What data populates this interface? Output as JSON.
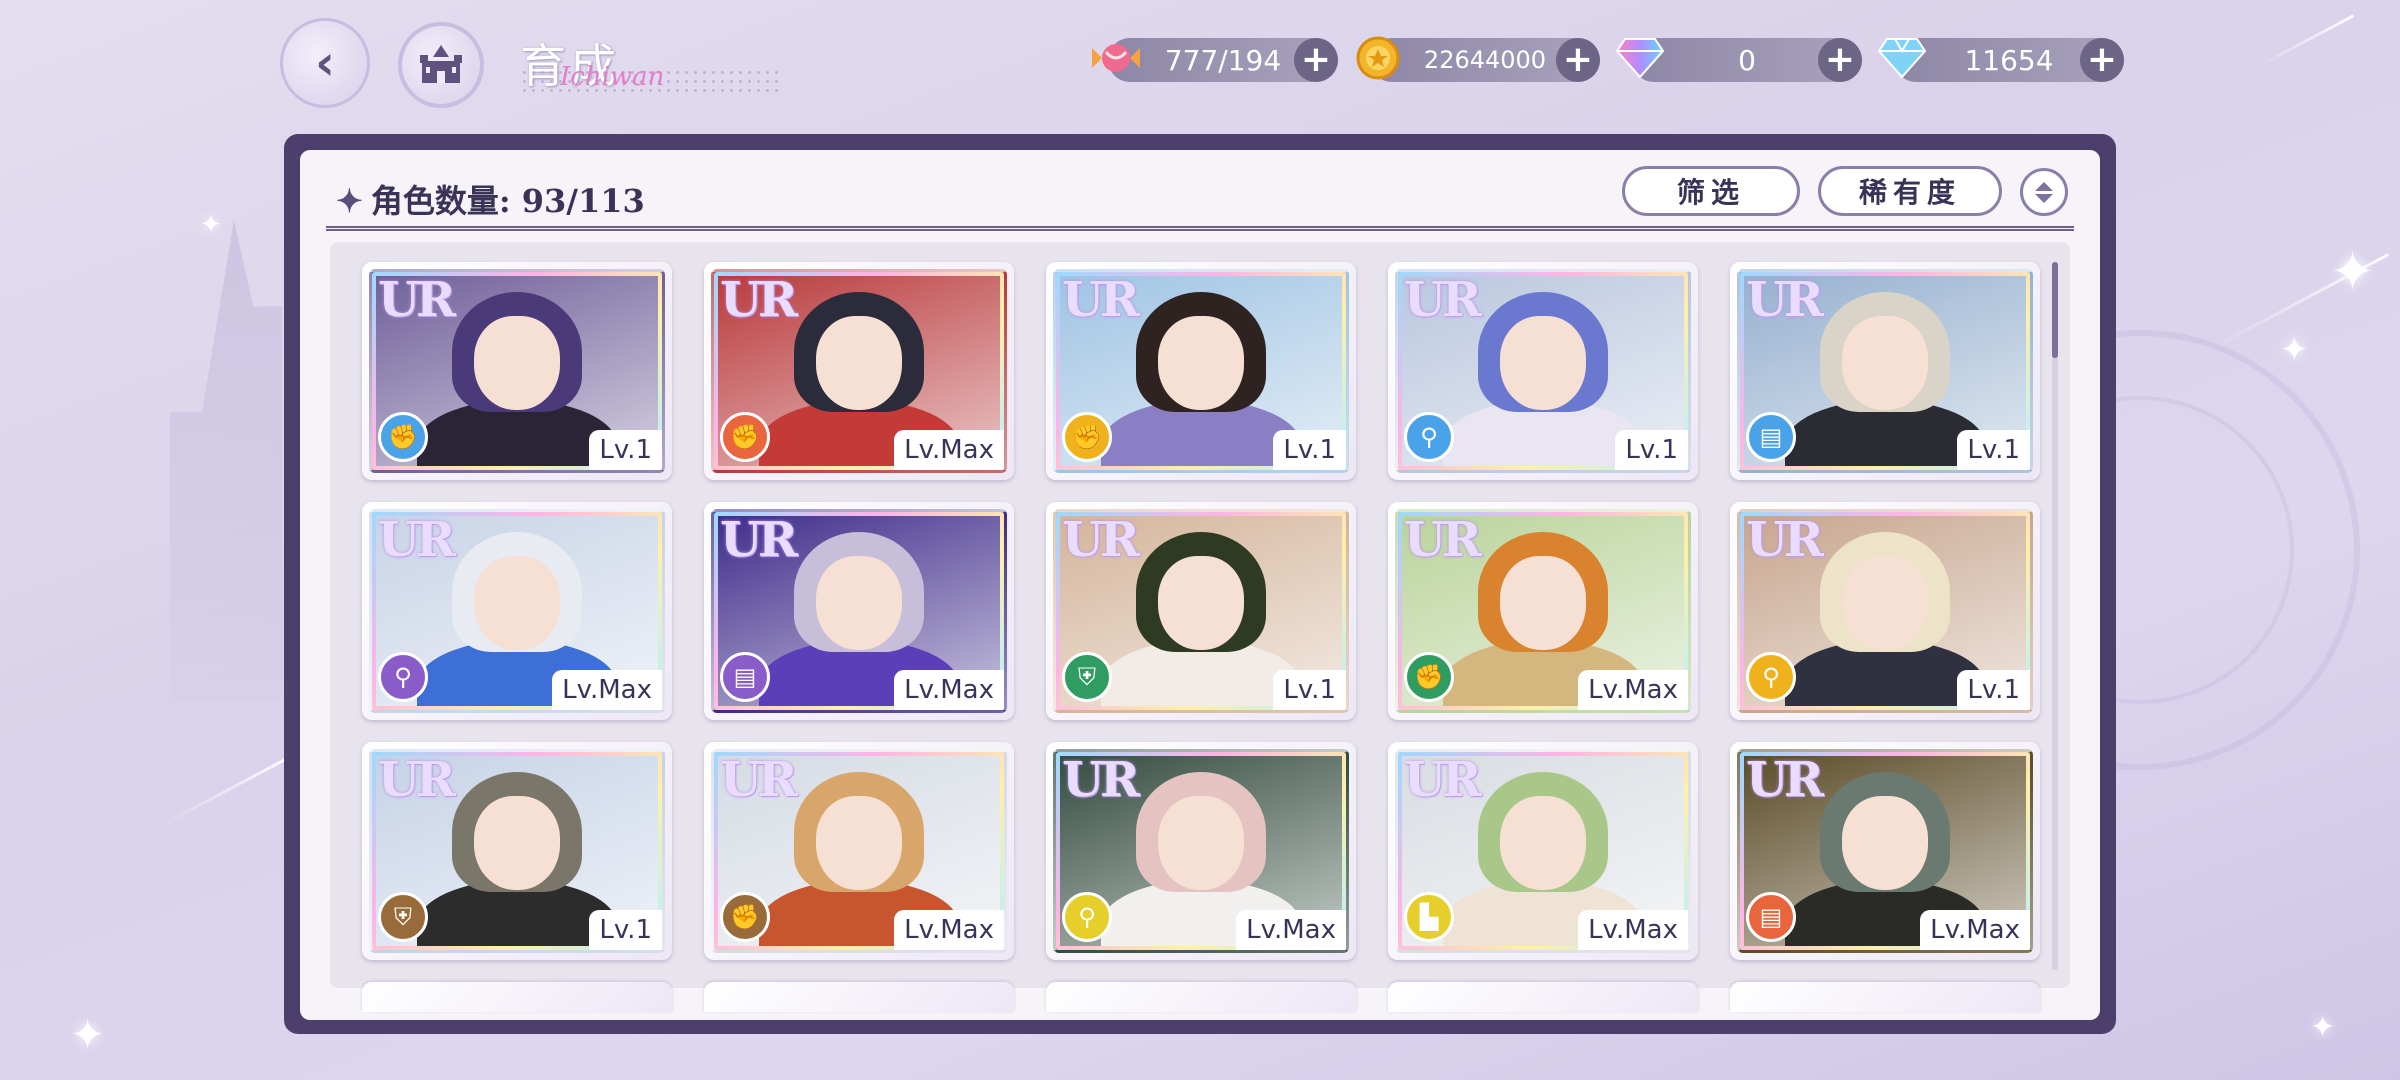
{
  "header": {
    "back_icon": "back-arrow-icon",
    "home_icon": "castle-icon",
    "title": "育成",
    "title_script": "Ichiwan"
  },
  "currencies": [
    {
      "name": "stamina",
      "icon": "candy-icon",
      "value": "777/194"
    },
    {
      "name": "gold",
      "icon": "coin-icon",
      "value": "22644000"
    },
    {
      "name": "paid-gem",
      "icon": "rainbow-gem-icon",
      "value": "0"
    },
    {
      "name": "free-gem",
      "icon": "diamond-icon",
      "value": "11654"
    }
  ],
  "panel": {
    "count_label": "角色数量: 93/113",
    "filter_label": "筛选",
    "sort_label": "稀有度"
  },
  "colors": {
    "frame": "#4d3f6b",
    "accent": "#8a7fa8",
    "class_blue": "#4aa3e8",
    "class_orange": "#f0b21c",
    "class_red": "#e9653d",
    "class_purple": "#8a5cc9",
    "class_green": "#2f9c62",
    "class_brown": "#9a6b3a",
    "class_yellow": "#e6cf2b"
  },
  "cards": [
    {
      "rarity": "UR",
      "class_icon": "fist-icon",
      "class_color": "#4aa3e8",
      "level": "Lv.1",
      "hair": "#4b3a7a",
      "bg": "#6e5e98",
      "outfit": "#2a2436"
    },
    {
      "rarity": "UR",
      "class_icon": "fist-icon",
      "class_color": "#e9653d",
      "level": "Lv.Max",
      "hair": "#2b2b3b",
      "bg": "#b8383a",
      "outfit": "#c43a36"
    },
    {
      "rarity": "UR",
      "class_icon": "fist-icon",
      "class_color": "#f0b21c",
      "level": "Lv.1",
      "hair": "#2e2320",
      "bg": "#9fc3e3",
      "outfit": "#8a7fc4"
    },
    {
      "rarity": "UR",
      "class_icon": "wand-icon",
      "class_color": "#4aa3e8",
      "level": "Lv.1",
      "hair": "#6b78d0",
      "bg": "#b9c6de",
      "outfit": "#e9e6f2"
    },
    {
      "rarity": "UR",
      "class_icon": "book-icon",
      "class_color": "#4aa3e8",
      "level": "Lv.1",
      "hair": "#d9d4c7",
      "bg": "#95b0cf",
      "outfit": "#2a2b33"
    },
    {
      "rarity": "UR",
      "class_icon": "wand-icon",
      "class_color": "#8a5cc9",
      "level": "Lv.Max",
      "hair": "#e8ebf2",
      "bg": "#c8d3e6",
      "outfit": "#3d6fd6"
    },
    {
      "rarity": "UR",
      "class_icon": "book-icon",
      "class_color": "#8a5cc9",
      "level": "Lv.Max",
      "hair": "#c7bfd9",
      "bg": "#3d2b8a",
      "outfit": "#5a3fb8"
    },
    {
      "rarity": "UR",
      "class_icon": "shield-icon",
      "class_color": "#2f9c62",
      "level": "Lv.1",
      "hair": "#2f3a22",
      "bg": "#d4b49a",
      "outfit": "#f1ede6"
    },
    {
      "rarity": "UR",
      "class_icon": "fist-icon",
      "class_color": "#2f9c62",
      "level": "Lv.Max",
      "hair": "#d9832e",
      "bg": "#b9d39a",
      "outfit": "#d4b77e"
    },
    {
      "rarity": "UR",
      "class_icon": "wand-icon",
      "class_color": "#f0b21c",
      "level": "Lv.1",
      "hair": "#ece3c8",
      "bg": "#c7a58d",
      "outfit": "#2f3040"
    },
    {
      "rarity": "UR",
      "class_icon": "shield-icon",
      "class_color": "#9a6b3a",
      "level": "Lv.1",
      "hair": "#7b766a",
      "bg": "#c5d2e6",
      "outfit": "#2c2c2c"
    },
    {
      "rarity": "UR",
      "class_icon": "fist-icon",
      "class_color": "#9a6b3a",
      "level": "Lv.Max",
      "hair": "#d8a66a",
      "bg": "#d5dbe4",
      "outfit": "#c7552e"
    },
    {
      "rarity": "UR",
      "class_icon": "wand-icon",
      "class_color": "#e6cf2b",
      "level": "Lv.Max",
      "hair": "#e4c3c0",
      "bg": "#324a3e",
      "outfit": "#f2f0ef"
    },
    {
      "rarity": "UR",
      "class_icon": "boot-icon",
      "class_color": "#e6cf2b",
      "level": "Lv.Max",
      "hair": "#a8c789",
      "bg": "#d8dde2",
      "outfit": "#efe3d6"
    },
    {
      "rarity": "UR",
      "class_icon": "book-icon",
      "class_color": "#e9653d",
      "level": "Lv.Max",
      "hair": "#6a7a70",
      "bg": "#5a4a26",
      "outfit": "#2a2a26"
    }
  ]
}
